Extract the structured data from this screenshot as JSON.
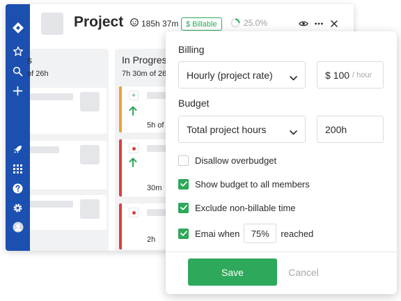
{
  "project": {
    "title": "Project",
    "time_tracked": "185h 37m",
    "billable_label": "Billable",
    "progress_label": "25.0%",
    "progress_fraction": 0.25
  },
  "board": {
    "columns": [
      {
        "title": "s",
        "subtitle": "of 26h"
      },
      {
        "title": "In Progress",
        "subtitle": "7h 30m of 26"
      }
    ],
    "cards": [
      {
        "time": "5h of"
      },
      {
        "time": "30m"
      },
      {
        "time": "2h"
      }
    ]
  },
  "billing": {
    "billing_label": "Billing",
    "rate_type": "Hourly (project rate)",
    "rate_amount": "$ 100",
    "rate_unit": "/ hour",
    "budget_label": "Budget",
    "budget_type": "Total project hours",
    "budget_amount": "200h",
    "options": [
      {
        "label": "Disallow overbudget",
        "checked": false
      },
      {
        "label": "Show budget to all members",
        "checked": true
      },
      {
        "label": "Exclude non-billable time",
        "checked": true
      }
    ],
    "email_prefix": "Emai when",
    "email_percent": "75%",
    "email_suffix": "reached",
    "email_checked": true,
    "save_label": "Save",
    "cancel_label": "Cancel"
  },
  "colors": {
    "sidebar": "#1b4fb0",
    "accent_green": "#2ea85a",
    "accent_orange": "#f0a030",
    "accent_red": "#d9413a"
  },
  "icons": {
    "sidebar": [
      "logo-icon",
      "star-icon",
      "search-icon",
      "plus-icon",
      "rocket-icon",
      "apps-grid-icon",
      "help-icon",
      "settings-icon",
      "user-avatar-icon"
    ],
    "header": [
      "clock-icon",
      "dollar-icon",
      "progress-ring-icon",
      "eye-icon",
      "more-icon",
      "close-icon"
    ]
  }
}
